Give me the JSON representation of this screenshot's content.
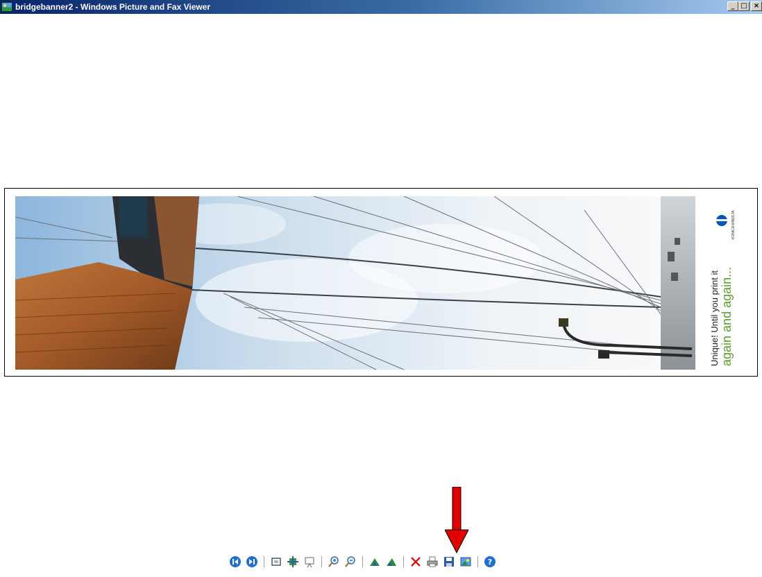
{
  "window": {
    "title": "bridgebanner2 - Windows Picture and Fax Viewer",
    "controls": [
      "_",
      "□",
      "×"
    ]
  },
  "banner": {
    "tagline_line1": "Unique! Until you print it",
    "tagline_line2": "again and again...",
    "brand": "KONICA MINOLTA"
  },
  "toolbar": {
    "buttons": [
      {
        "name": "previous-image-icon"
      },
      {
        "name": "next-image-icon"
      },
      {
        "name": "best-fit-icon"
      },
      {
        "name": "actual-size-icon"
      },
      {
        "name": "slideshow-icon"
      },
      {
        "name": "zoom-in-icon"
      },
      {
        "name": "zoom-out-icon"
      },
      {
        "name": "rotate-clockwise-icon"
      },
      {
        "name": "rotate-counterclockwise-icon"
      },
      {
        "name": "delete-icon"
      },
      {
        "name": "print-icon"
      },
      {
        "name": "save-icon"
      },
      {
        "name": "open-for-editing-icon"
      },
      {
        "name": "help-icon"
      }
    ]
  },
  "colors": {
    "title_gradient_start": "#0a246a",
    "title_gradient_end": "#a6caf0",
    "annotation_arrow": "#e00000",
    "tagline_green": "#5a9e2e",
    "brand_blue": "#0057b8"
  }
}
